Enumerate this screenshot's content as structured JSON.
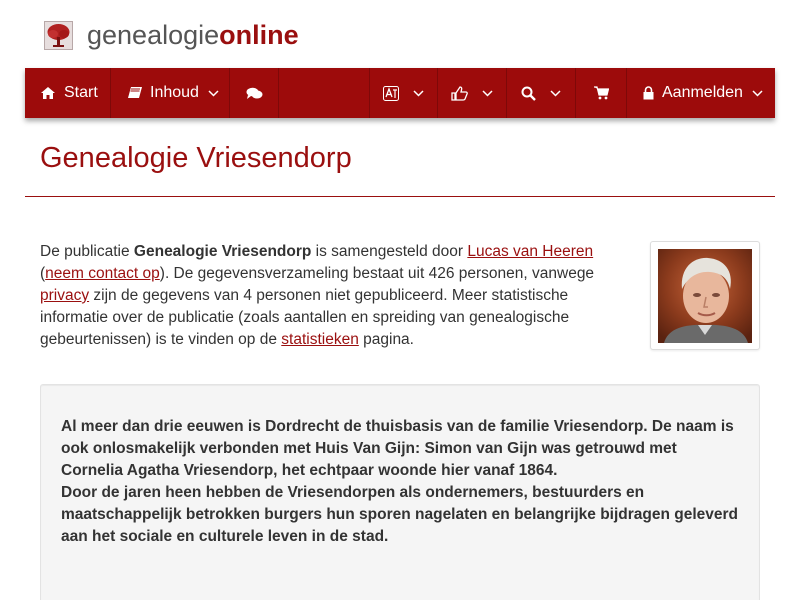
{
  "brand": {
    "name_plain": "genealogie",
    "name_accent": "online"
  },
  "nav": {
    "start_label": "Start",
    "contents_label": "Inhoud",
    "login_label": "Aanmelden"
  },
  "page": {
    "title": "Genealogie Vriesendorp"
  },
  "intro": {
    "t1": "De publicatie ",
    "pub_name": "Genealogie Vriesendorp",
    "t2": " is samengesteld door ",
    "author_link": "Lucas van Heeren",
    "t3": " (",
    "contact_link": "neem contact op",
    "t4": "). De gegevensverzameling bestaat uit 426 personen, vanwege ",
    "privacy_link": "privacy",
    "t5": " zijn de gegevens van 4 personen niet gepubliceerd. Meer statistische informatie over de publicatie (zoals aantallen en spreiding van genealogische gebeurtenissen) is te vinden op de ",
    "stats_link": "statistieken",
    "t6": " pagina."
  },
  "description": {
    "p1": "Al meer dan drie eeuwen is Dordrecht de thuisbasis van de familie Vriesendorp. De naam is ook onlosmakelijk verbonden met Huis Van Gijn: Simon van Gijn was getrouwd met Cornelia Agatha Vriesendorp, het echtpaar woonde hier vanaf 1864.",
    "p2": "Door de jaren heen hebben de Vriesendorpen als ondernemers, bestuurders en maatschappelijk betrokken burgers hun sporen nagelaten en belangrijke bijdragen geleverd aan het sociale en culturele leven in de stad."
  },
  "colors": {
    "brand_red": "#9d0b0b",
    "link_red": "#9a0f0f",
    "panel_bg": "#f5f5f5"
  },
  "icons": [
    "tree-logo-icon",
    "home-icon",
    "book-icon",
    "comments-icon",
    "translate-icon",
    "thumbs-up-icon",
    "search-icon",
    "cart-icon",
    "lock-icon",
    "chevron-down-icon"
  ]
}
